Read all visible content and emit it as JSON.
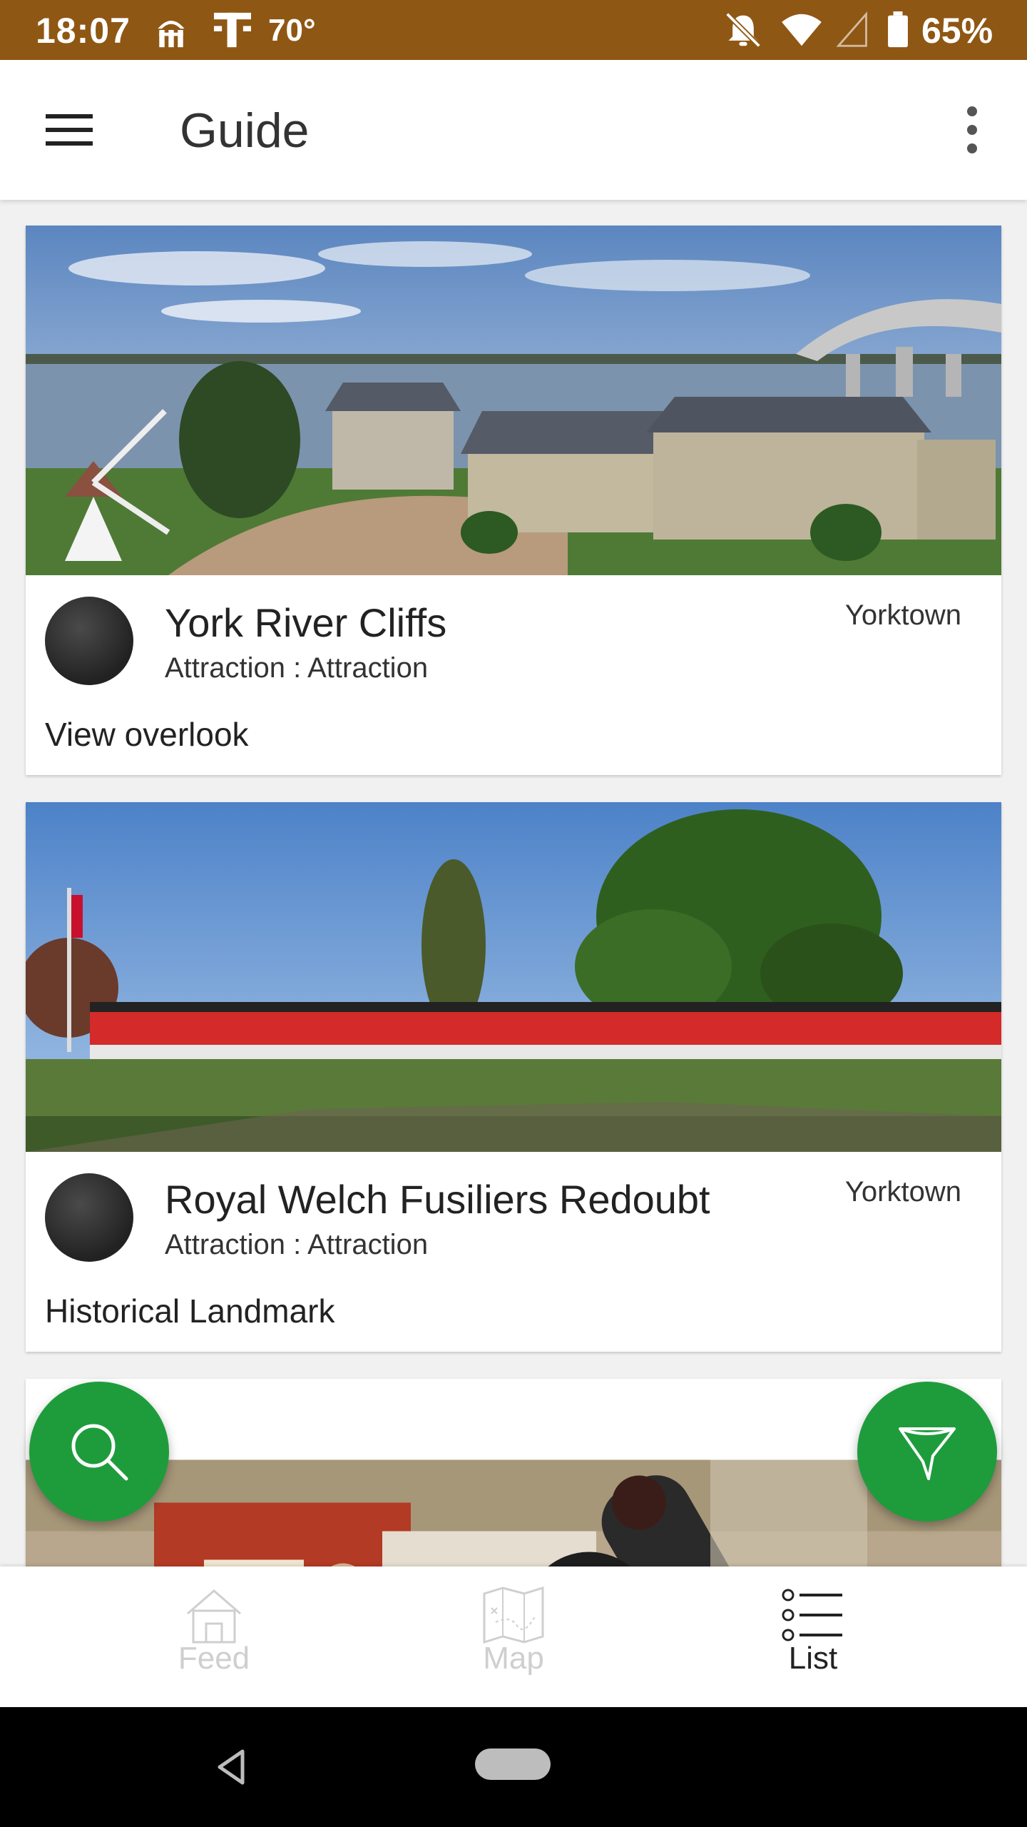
{
  "status_bar": {
    "time": "18:07",
    "temperature": "70°",
    "battery_percent": "65%",
    "icons": [
      "fork-knife-icon",
      "t-mobile-icon",
      "notifications-off-icon",
      "wifi-icon",
      "signal-icon",
      "battery-icon"
    ]
  },
  "app_bar": {
    "title": "Guide",
    "menu_icon": "hamburger-menu-icon",
    "overflow_icon": "more-vert-icon"
  },
  "cards": [
    {
      "name": "York River Cliffs",
      "category": "Attraction : Attraction",
      "location": "Yorktown",
      "description": "View overlook",
      "image": "york-river-waterfront-photo"
    },
    {
      "name": "Royal Welch Fusiliers Redoubt",
      "category": "Attraction : Attraction",
      "location": "Yorktown",
      "description": "Historical Landmark",
      "image": "redcoat-soldiers-photo"
    },
    {
      "image": "museum-cannon-photo"
    }
  ],
  "fabs": {
    "search_icon": "search-icon",
    "filter_icon": "filter-icon"
  },
  "bottom_nav": [
    {
      "label": "Feed",
      "icon": "home-icon",
      "active": false
    },
    {
      "label": "Map",
      "icon": "map-icon",
      "active": false
    },
    {
      "label": "List",
      "icon": "list-icon",
      "active": true
    }
  ],
  "colors": {
    "status_bar": "#8f5714",
    "accent_green": "#1e9c3c",
    "inactive_nav": "#cfcfcf"
  }
}
